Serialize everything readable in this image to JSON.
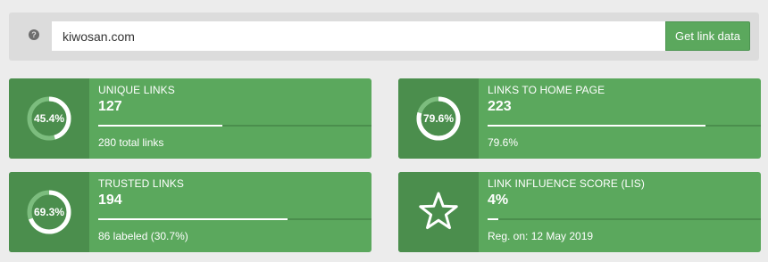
{
  "search": {
    "help_icon": "question-circle-icon",
    "value": "kiwosan.com",
    "button_label": "Get link data"
  },
  "cards": [
    {
      "icon_type": "ring",
      "ring_percent": 45.4,
      "ring_label": "45.4%",
      "title": "UNIQUE LINKS",
      "value": "127",
      "bar_fill_fraction": 0.454,
      "subtext": "280 total links"
    },
    {
      "icon_type": "ring",
      "ring_percent": 79.6,
      "ring_label": "79.6%",
      "title": "LINKS TO HOME PAGE",
      "value": "223",
      "bar_fill_fraction": 0.796,
      "subtext": "79.6%"
    },
    {
      "icon_type": "ring",
      "ring_percent": 69.3,
      "ring_label": "69.3%",
      "title": "TRUSTED LINKS",
      "value": "194",
      "bar_fill_fraction": 0.693,
      "subtext": "86 labeled (30.7%)"
    },
    {
      "icon_type": "star-outline-icon",
      "title": "LINK INFLUENCE SCORE (LIS)",
      "value": "4%",
      "bar_fill_fraction": 0.04,
      "subtext": "Reg. on: 12 May 2019"
    }
  ],
  "colors": {
    "background": "#ececec",
    "search_bar": "#dcdcdc",
    "card": "#5ba85d",
    "card_dark": "#4b8e4d",
    "ring_track": "#7cbd7e",
    "white": "#ffffff"
  }
}
